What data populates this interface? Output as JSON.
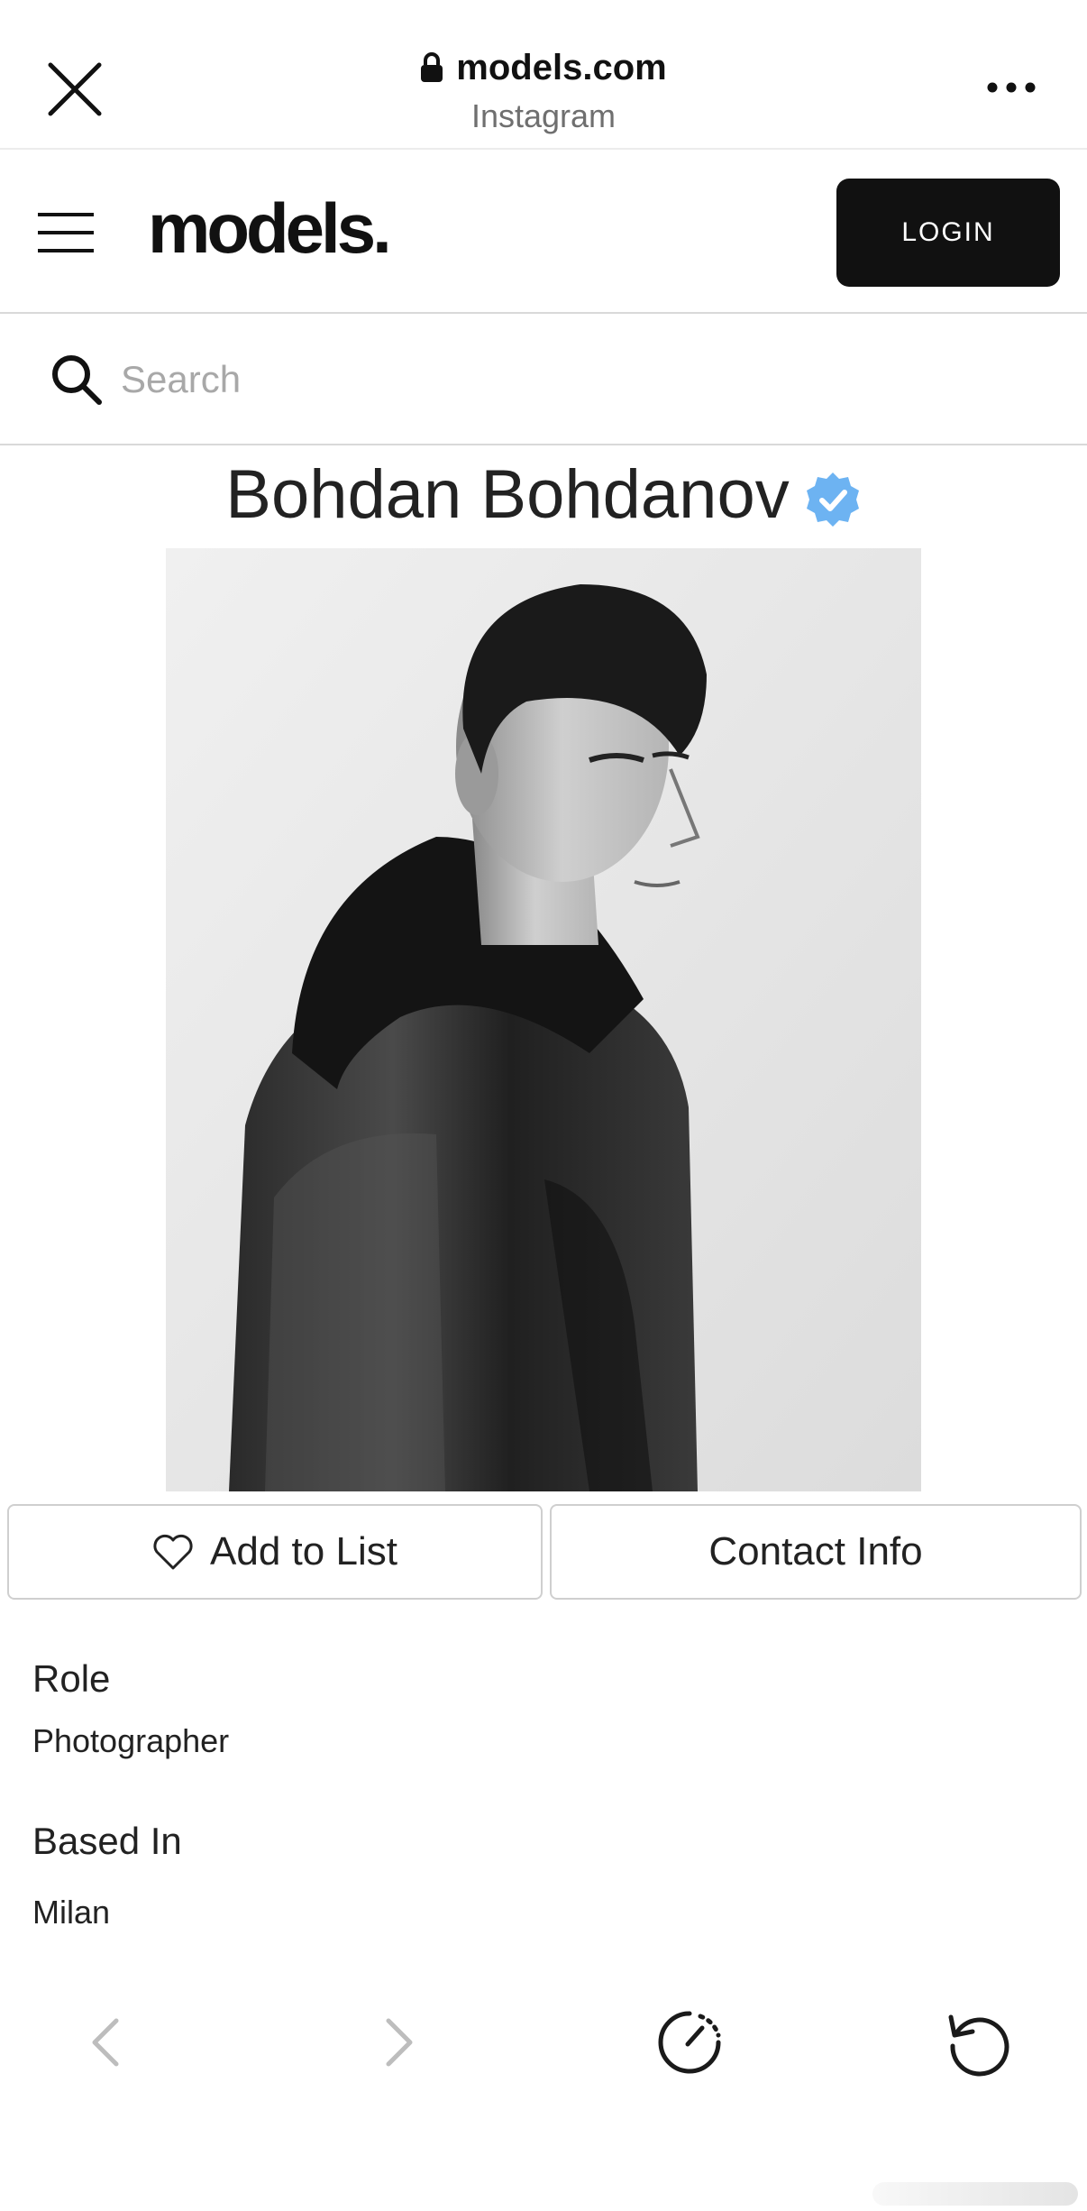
{
  "browser": {
    "domain": "models.com",
    "source": "Instagram",
    "icons": {
      "close": "close-icon",
      "lock": "lock-icon",
      "more": "more-icon"
    }
  },
  "header": {
    "logo": "models.",
    "login_label": "LOGIN",
    "menu_icon": "hamburger-menu-icon"
  },
  "search": {
    "placeholder": "Search",
    "value": ""
  },
  "profile": {
    "name": "Bohdan Bohdanov",
    "verified": true,
    "verified_color": "#6db3f2",
    "actions": {
      "add_to_list_label": "Add to List",
      "contact_info_label": "Contact Info"
    },
    "details": [
      {
        "label": "Role",
        "value": "Photographer"
      },
      {
        "label": "Based In",
        "value": "Milan"
      }
    ]
  },
  "bottom_toolbar": {
    "items": [
      "back-icon",
      "forward-icon",
      "speed-icon",
      "reload-icon"
    ],
    "disabled_color": "#bdbdbd",
    "active_color": "#1a1a1a"
  },
  "colors": {
    "login_bg": "#111111",
    "border": "#d9d9d9",
    "placeholder": "#a8a8a8"
  }
}
